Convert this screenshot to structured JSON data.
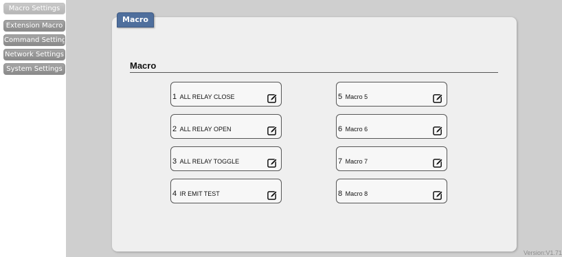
{
  "sidebar": {
    "items": [
      {
        "label": "Macro Settings",
        "active": true
      },
      {
        "label": "Extension Macro",
        "active": false
      },
      {
        "label": "Command Settings",
        "active": false
      },
      {
        "label": "Network Settings",
        "active": false
      },
      {
        "label": "System Settings",
        "active": false
      }
    ]
  },
  "main": {
    "tab_label": "Macro",
    "section_heading": "Macro",
    "macros": [
      {
        "number": "1",
        "name": "ALL RELAY CLOSE",
        "icon": "edit-icon"
      },
      {
        "number": "2",
        "name": "ALL RELAY OPEN",
        "icon": "edit-icon"
      },
      {
        "number": "3",
        "name": "ALL RELAY TOGGLE",
        "icon": "edit-icon"
      },
      {
        "number": "4",
        "name": "IR EMIT TEST",
        "icon": "edit-icon"
      },
      {
        "number": "5",
        "name": "Macro 5",
        "icon": "edit-icon"
      },
      {
        "number": "6",
        "name": "Macro 6",
        "icon": "edit-icon"
      },
      {
        "number": "7",
        "name": "Macro 7",
        "icon": "edit-icon"
      },
      {
        "number": "8",
        "name": "Macro 8",
        "icon": "edit-icon"
      }
    ]
  },
  "footer": {
    "version": "Version:V1.71"
  },
  "colors": {
    "tab_blue": "#4f6f9d",
    "sidebar_gray": "#969696",
    "panel_bg": "#efefef",
    "page_bg": "#cfcfcf"
  }
}
